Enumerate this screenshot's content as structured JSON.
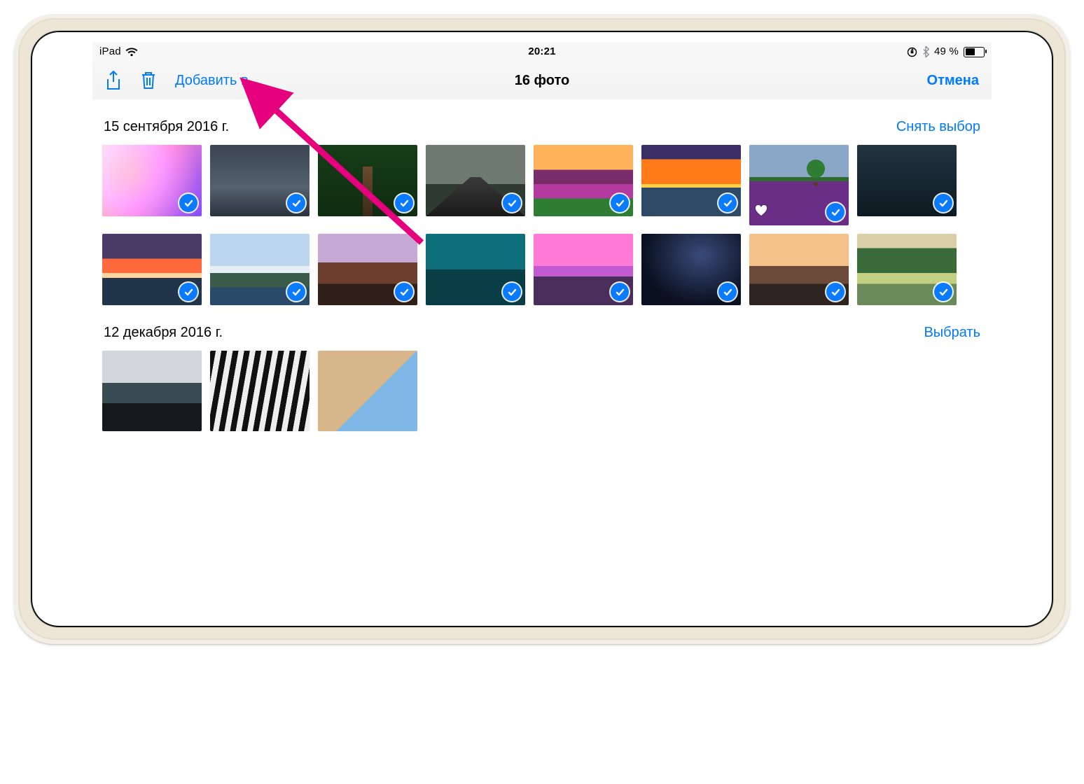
{
  "status_bar": {
    "device": "iPad",
    "time": "20:21",
    "battery_text": "49 %",
    "battery_level": 49
  },
  "nav": {
    "share_icon": "share-icon",
    "trash_icon": "trash-icon",
    "add_to": "Добавить в",
    "title": "16 фото",
    "cancel": "Отмена"
  },
  "sections": [
    {
      "title": "15 сентября 2016 г.",
      "action": "Снять выбор",
      "photos": [
        {
          "name": "photo-1",
          "selected": true,
          "favorite": false,
          "art": "nebula"
        },
        {
          "name": "photo-2",
          "selected": true,
          "favorite": false,
          "art": "fogcity"
        },
        {
          "name": "photo-3",
          "selected": true,
          "favorite": false,
          "art": "forest"
        },
        {
          "name": "photo-4",
          "selected": true,
          "favorite": false,
          "art": "road"
        },
        {
          "name": "photo-5",
          "selected": true,
          "favorite": false,
          "art": "meadow"
        },
        {
          "name": "photo-6",
          "selected": true,
          "favorite": false,
          "art": "sunset-sea"
        },
        {
          "name": "photo-7",
          "selected": true,
          "favorite": true,
          "art": "lavender",
          "tall": true
        },
        {
          "name": "photo-8",
          "selected": true,
          "favorite": false,
          "art": "bike"
        },
        {
          "name": "photo-9",
          "selected": true,
          "favorite": false,
          "art": "dusk"
        },
        {
          "name": "photo-10",
          "selected": true,
          "favorite": false,
          "art": "alaska"
        },
        {
          "name": "photo-11",
          "selected": true,
          "favorite": false,
          "art": "ridges"
        },
        {
          "name": "photo-12",
          "selected": true,
          "favorite": false,
          "art": "reef"
        },
        {
          "name": "photo-13",
          "selected": true,
          "favorite": false,
          "art": "pink-mtn"
        },
        {
          "name": "photo-14",
          "selected": true,
          "favorite": false,
          "art": "milkyway"
        },
        {
          "name": "photo-15",
          "selected": true,
          "favorite": false,
          "art": "bromo"
        },
        {
          "name": "photo-16",
          "selected": true,
          "favorite": false,
          "art": "valley"
        }
      ]
    },
    {
      "title": "12 декабря 2016 г.",
      "action": "Выбрать",
      "photos": [
        {
          "name": "photo-b1",
          "selected": false,
          "favorite": false,
          "art": "coast",
          "tall": true
        },
        {
          "name": "photo-b2",
          "selected": false,
          "favorite": false,
          "art": "zebra",
          "tall": true
        },
        {
          "name": "photo-b3",
          "selected": false,
          "favorite": false,
          "art": "building",
          "tall": true
        }
      ]
    }
  ],
  "annotation": {
    "target": "add-to-button"
  },
  "colors": {
    "accent": "#007aff",
    "arrow": "#e6007e"
  }
}
